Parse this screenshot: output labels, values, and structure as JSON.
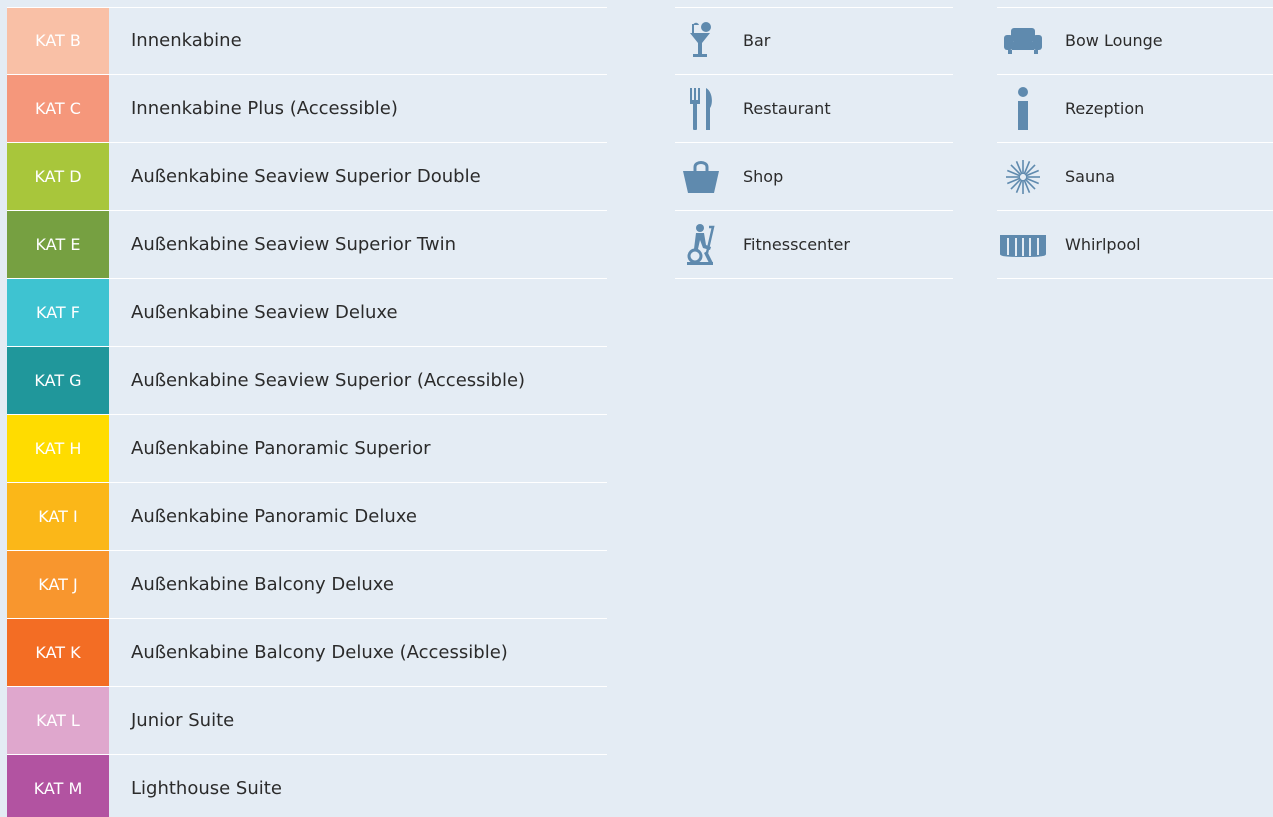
{
  "categories": [
    {
      "code": "KAT B",
      "label": "Innenkabine",
      "color": "#f9c0a6"
    },
    {
      "code": "KAT C",
      "label": "Innenkabine Plus (Accessible)",
      "color": "#f5977b"
    },
    {
      "code": "KAT D",
      "label": "Außenkabine Seaview Superior Double",
      "color": "#a8c63b"
    },
    {
      "code": "KAT E",
      "label": "Außenkabine Seaview Superior Twin",
      "color": "#76a041"
    },
    {
      "code": "KAT F",
      "label": "Außenkabine Seaview Deluxe",
      "color": "#3ec3d1"
    },
    {
      "code": "KAT G",
      "label": "Außenkabine Seaview Superior (Accessible)",
      "color": "#20979b"
    },
    {
      "code": "KAT H",
      "label": "Außenkabine Panoramic Superior",
      "color": "#ffdc00"
    },
    {
      "code": "KAT I",
      "label": "Außenkabine Panoramic Deluxe",
      "color": "#fbb718"
    },
    {
      "code": "KAT J",
      "label": "Außenkabine Balcony Deluxe",
      "color": "#f8962e"
    },
    {
      "code": "KAT K",
      "label": "Außenkabine Balcony Deluxe (Accessible)",
      "color": "#f36d24"
    },
    {
      "code": "KAT L",
      "label": "Junior Suite",
      "color": "#dfa7cd"
    },
    {
      "code": "KAT M",
      "label": "Lighthouse Suite",
      "color": "#b253a1"
    }
  ],
  "amenities_left": [
    {
      "icon": "cocktail-icon",
      "label": "Bar"
    },
    {
      "icon": "cutlery-icon",
      "label": "Restaurant"
    },
    {
      "icon": "shopping-bag-icon",
      "label": "Shop"
    },
    {
      "icon": "exercise-bike-icon",
      "label": "Fitnesscenter"
    }
  ],
  "amenities_right": [
    {
      "icon": "armchair-icon",
      "label": "Bow Lounge"
    },
    {
      "icon": "info-icon",
      "label": "Rezeption"
    },
    {
      "icon": "sauna-burst-icon",
      "label": "Sauna"
    },
    {
      "icon": "whirlpool-tub-icon",
      "label": "Whirlpool"
    }
  ],
  "icon_color": "#5f8aae"
}
